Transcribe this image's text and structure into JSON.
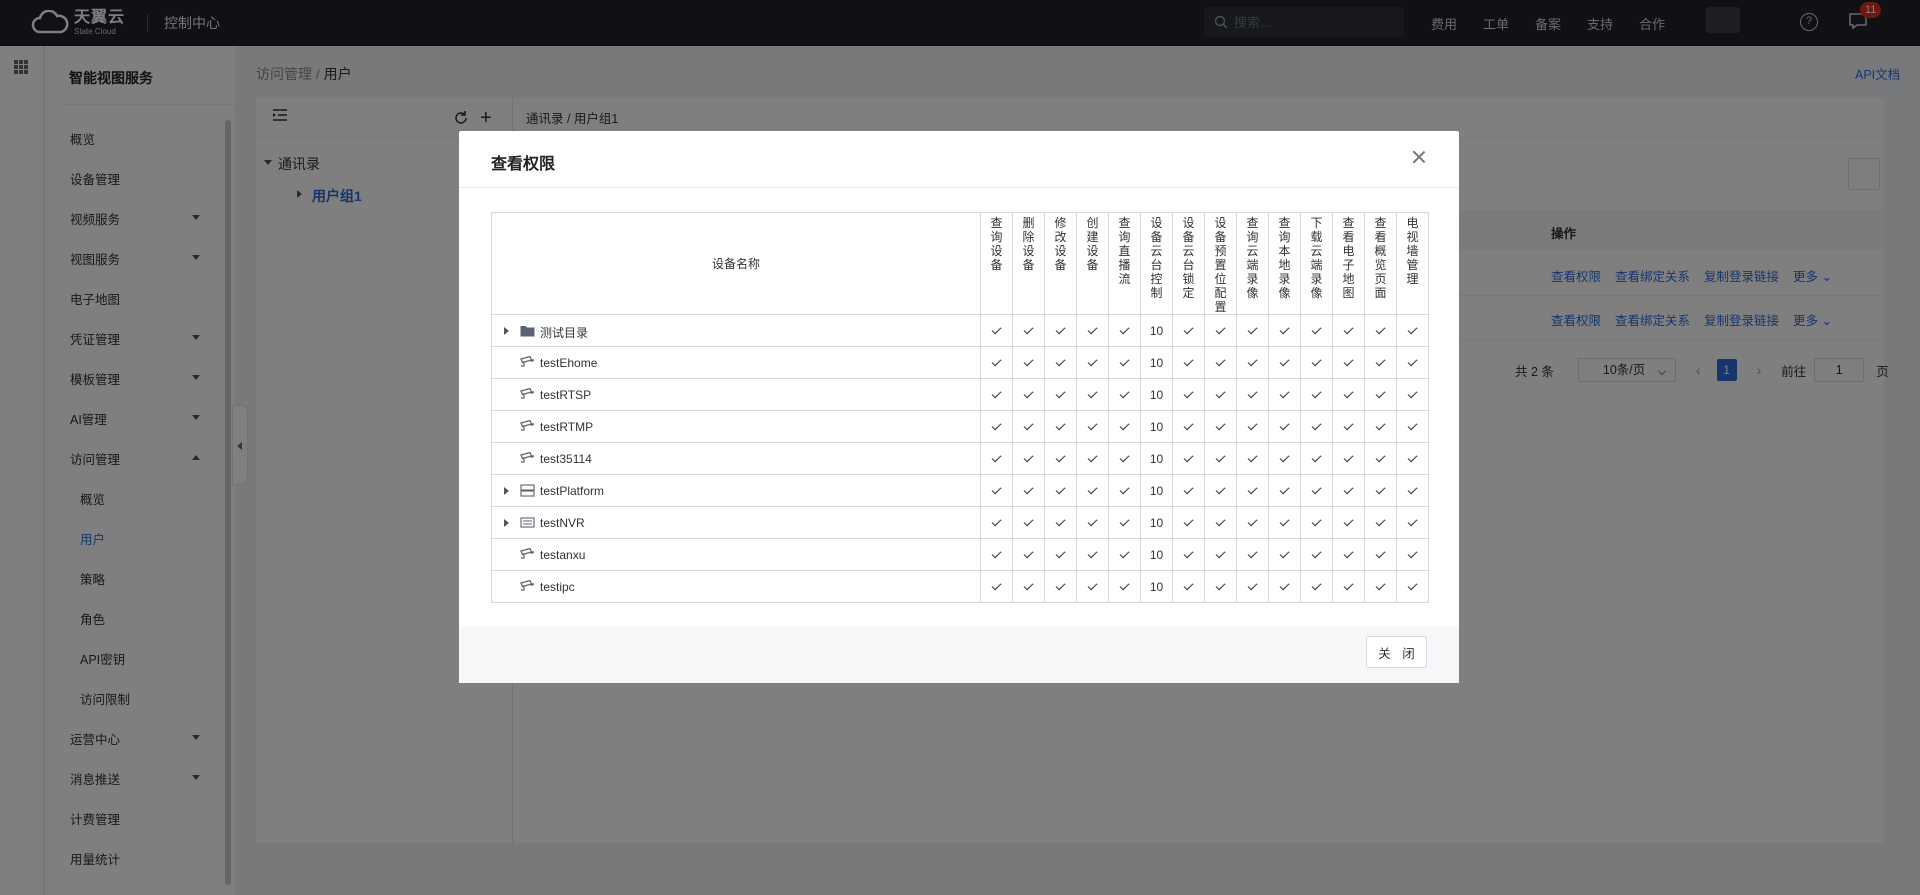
{
  "topbar": {
    "brand_cn": "天翼云",
    "brand_en": "State Cloud",
    "console": "控制中心",
    "search_placeholder": "搜索...",
    "nav": [
      "费用",
      "工单",
      "备案",
      "支持",
      "合作"
    ],
    "badge_count": "11"
  },
  "sidebar": {
    "title": "智能视图服务",
    "items": [
      {
        "label": "概览"
      },
      {
        "label": "设备管理"
      },
      {
        "label": "视频服务"
      },
      {
        "label": "视图服务"
      },
      {
        "label": "电子地图"
      },
      {
        "label": "凭证管理"
      },
      {
        "label": "模板管理"
      },
      {
        "label": "AI管理"
      },
      {
        "label": "访问管理"
      },
      {
        "label": "概览"
      },
      {
        "label": "用户"
      },
      {
        "label": "策略"
      },
      {
        "label": "角色"
      },
      {
        "label": "API密钥"
      },
      {
        "label": "访问限制"
      },
      {
        "label": "运营中心"
      },
      {
        "label": "消息推送"
      },
      {
        "label": "计费管理"
      },
      {
        "label": "用量统计"
      }
    ]
  },
  "breadcrumb": {
    "parent": "访问管理",
    "sep": " / ",
    "current": "用户"
  },
  "api_doc": "API文档",
  "tree": {
    "root": "通讯录",
    "child": "用户组1"
  },
  "right_path": "通讯录 / 用户组1",
  "table": {
    "ops_header": "操作",
    "ops": [
      "查看权限",
      "查看绑定关系",
      "复制登录链接",
      "更多"
    ]
  },
  "pager": {
    "total": "共 2 条",
    "size": "10条/页",
    "current": "1",
    "goto": "前往",
    "input": "1",
    "unit": "页"
  },
  "modal": {
    "title": "查看权限",
    "close_label": "关 闭",
    "name_header": "设备名称",
    "columns": [
      "查询设备",
      "删除设备",
      "修改设备",
      "创建设备",
      "查询直播流",
      "设备云台控制",
      "设备云台锁定",
      "设备预置位配置",
      "查询云端录像",
      "查询本地录像",
      "下载云端录像",
      "查看电子地图",
      "查看概览页面",
      "电视墙管理"
    ],
    "rows": [
      {
        "name": "测试目录",
        "type": "folder",
        "expandable": true,
        "ptz": "10"
      },
      {
        "name": "testEhome",
        "type": "camera",
        "expandable": false,
        "ptz": "10"
      },
      {
        "name": "testRTSP",
        "type": "camera",
        "expandable": false,
        "ptz": "10"
      },
      {
        "name": "testRTMP",
        "type": "camera",
        "expandable": false,
        "ptz": "10"
      },
      {
        "name": "test35114",
        "type": "camera",
        "expandable": false,
        "ptz": "10"
      },
      {
        "name": "testPlatform",
        "type": "platform",
        "expandable": true,
        "ptz": "10"
      },
      {
        "name": "testNVR",
        "type": "nvr",
        "expandable": true,
        "ptz": "10"
      },
      {
        "name": "testanxu",
        "type": "camera",
        "expandable": false,
        "ptz": "10"
      },
      {
        "name": "testipc",
        "type": "camera",
        "expandable": false,
        "ptz": "10"
      }
    ]
  }
}
